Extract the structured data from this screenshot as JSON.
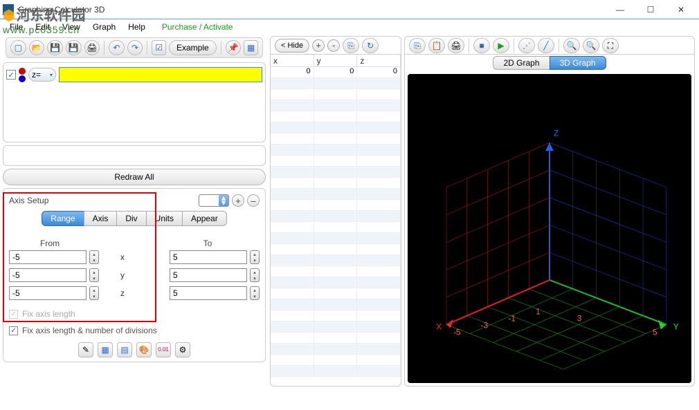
{
  "window": {
    "title": "Graphing Calculator 3D",
    "min": "—",
    "max": "☐",
    "close": "✕"
  },
  "watermark": {
    "site_cn": "河东软件园",
    "url": "www.pc0359.cn"
  },
  "menu": {
    "file": "File",
    "edit": "Edit",
    "view": "View",
    "graph": "Graph",
    "help": "Help",
    "purchase": "Purchase / Activate"
  },
  "toolbar_left": {
    "example": "Example"
  },
  "formula": {
    "z_label": "z=",
    "value": ""
  },
  "redraw": "Redraw All",
  "axis_setup": {
    "title": "Axis Setup",
    "plus": "+",
    "minus": "–",
    "tabs": [
      "Range",
      "Axis",
      "Div",
      "Units",
      "Appear"
    ],
    "active_tab": "Range",
    "from": "From",
    "to": "To",
    "rows": [
      {
        "axis": "x",
        "from": "-5",
        "to": "5"
      },
      {
        "axis": "y",
        "from": "-5",
        "to": "5"
      },
      {
        "axis": "z",
        "from": "-5",
        "to": "5"
      }
    ],
    "fix_len": "Fix axis length",
    "fix_div": "Fix axis length & number of divisions"
  },
  "mid": {
    "hide": "< Hide",
    "plus": "+",
    "minus": "-",
    "cols": [
      "x",
      "y",
      "z"
    ],
    "row0": [
      "0",
      "0",
      "0"
    ]
  },
  "right": {
    "tabs": {
      "g2d": "2D Graph",
      "g3d": "3D Graph"
    },
    "axes": {
      "x": "X",
      "y": "Y",
      "z": "Z"
    },
    "ticks": [
      "-5",
      "-3",
      "-1",
      "1",
      "3",
      "5"
    ]
  }
}
